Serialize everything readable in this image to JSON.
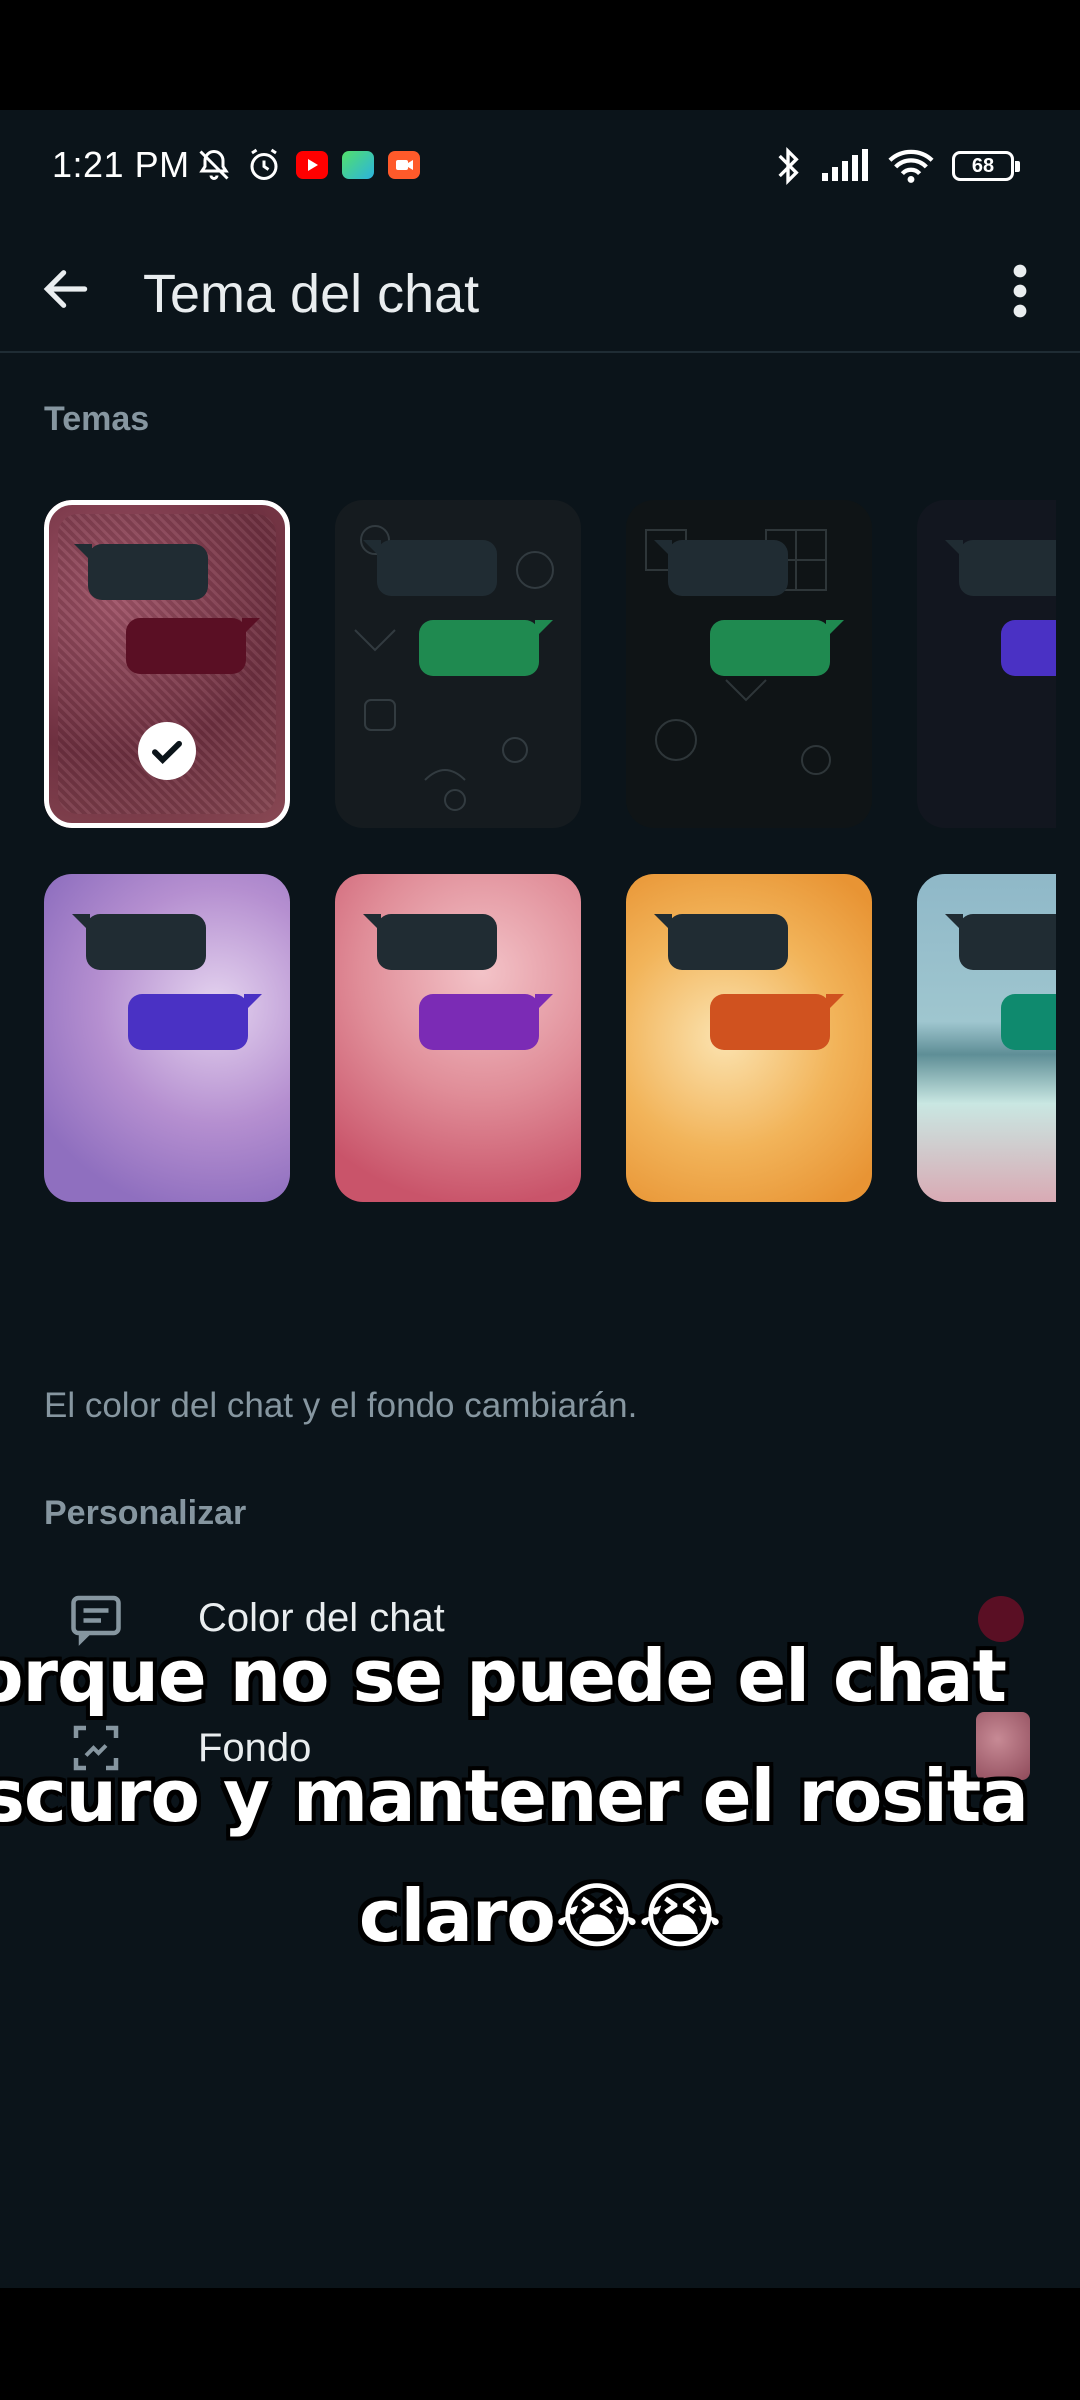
{
  "status_bar": {
    "time": "1:21 PM",
    "battery": "68"
  },
  "header": {
    "title": "Tema del chat"
  },
  "themes_section": {
    "heading": "Temas",
    "tiles": [
      {
        "name": "rosa-texturizado",
        "selected": true
      },
      {
        "name": "doodle-verde-1",
        "selected": false
      },
      {
        "name": "doodle-verde-2",
        "selected": false
      },
      {
        "name": "doodle-morado",
        "selected": false
      },
      {
        "name": "lila",
        "selected": false
      },
      {
        "name": "rosa-flores",
        "selected": false
      },
      {
        "name": "naranja",
        "selected": false
      },
      {
        "name": "playa",
        "selected": false
      }
    ],
    "note": "El color del chat y el fondo cambiarán."
  },
  "customize_section": {
    "heading": "Personalizar",
    "chat_color_label": "Color del chat",
    "background_label": "Fondo"
  },
  "overlay_caption": {
    "line1": "orque no se puede el chat",
    "line2": "scuro y mantener el rosita",
    "line3": "claro😭😭"
  },
  "colors": {
    "background": "#0b141a",
    "selected_bubble": "#5a0f24",
    "green_bubble": "#1f8a50",
    "purple_bubble": "#4a31c4",
    "violet_bubble": "#7b2bb5",
    "orange_bubble": "#d0521f",
    "teal_bubble": "#0f8a6e"
  }
}
